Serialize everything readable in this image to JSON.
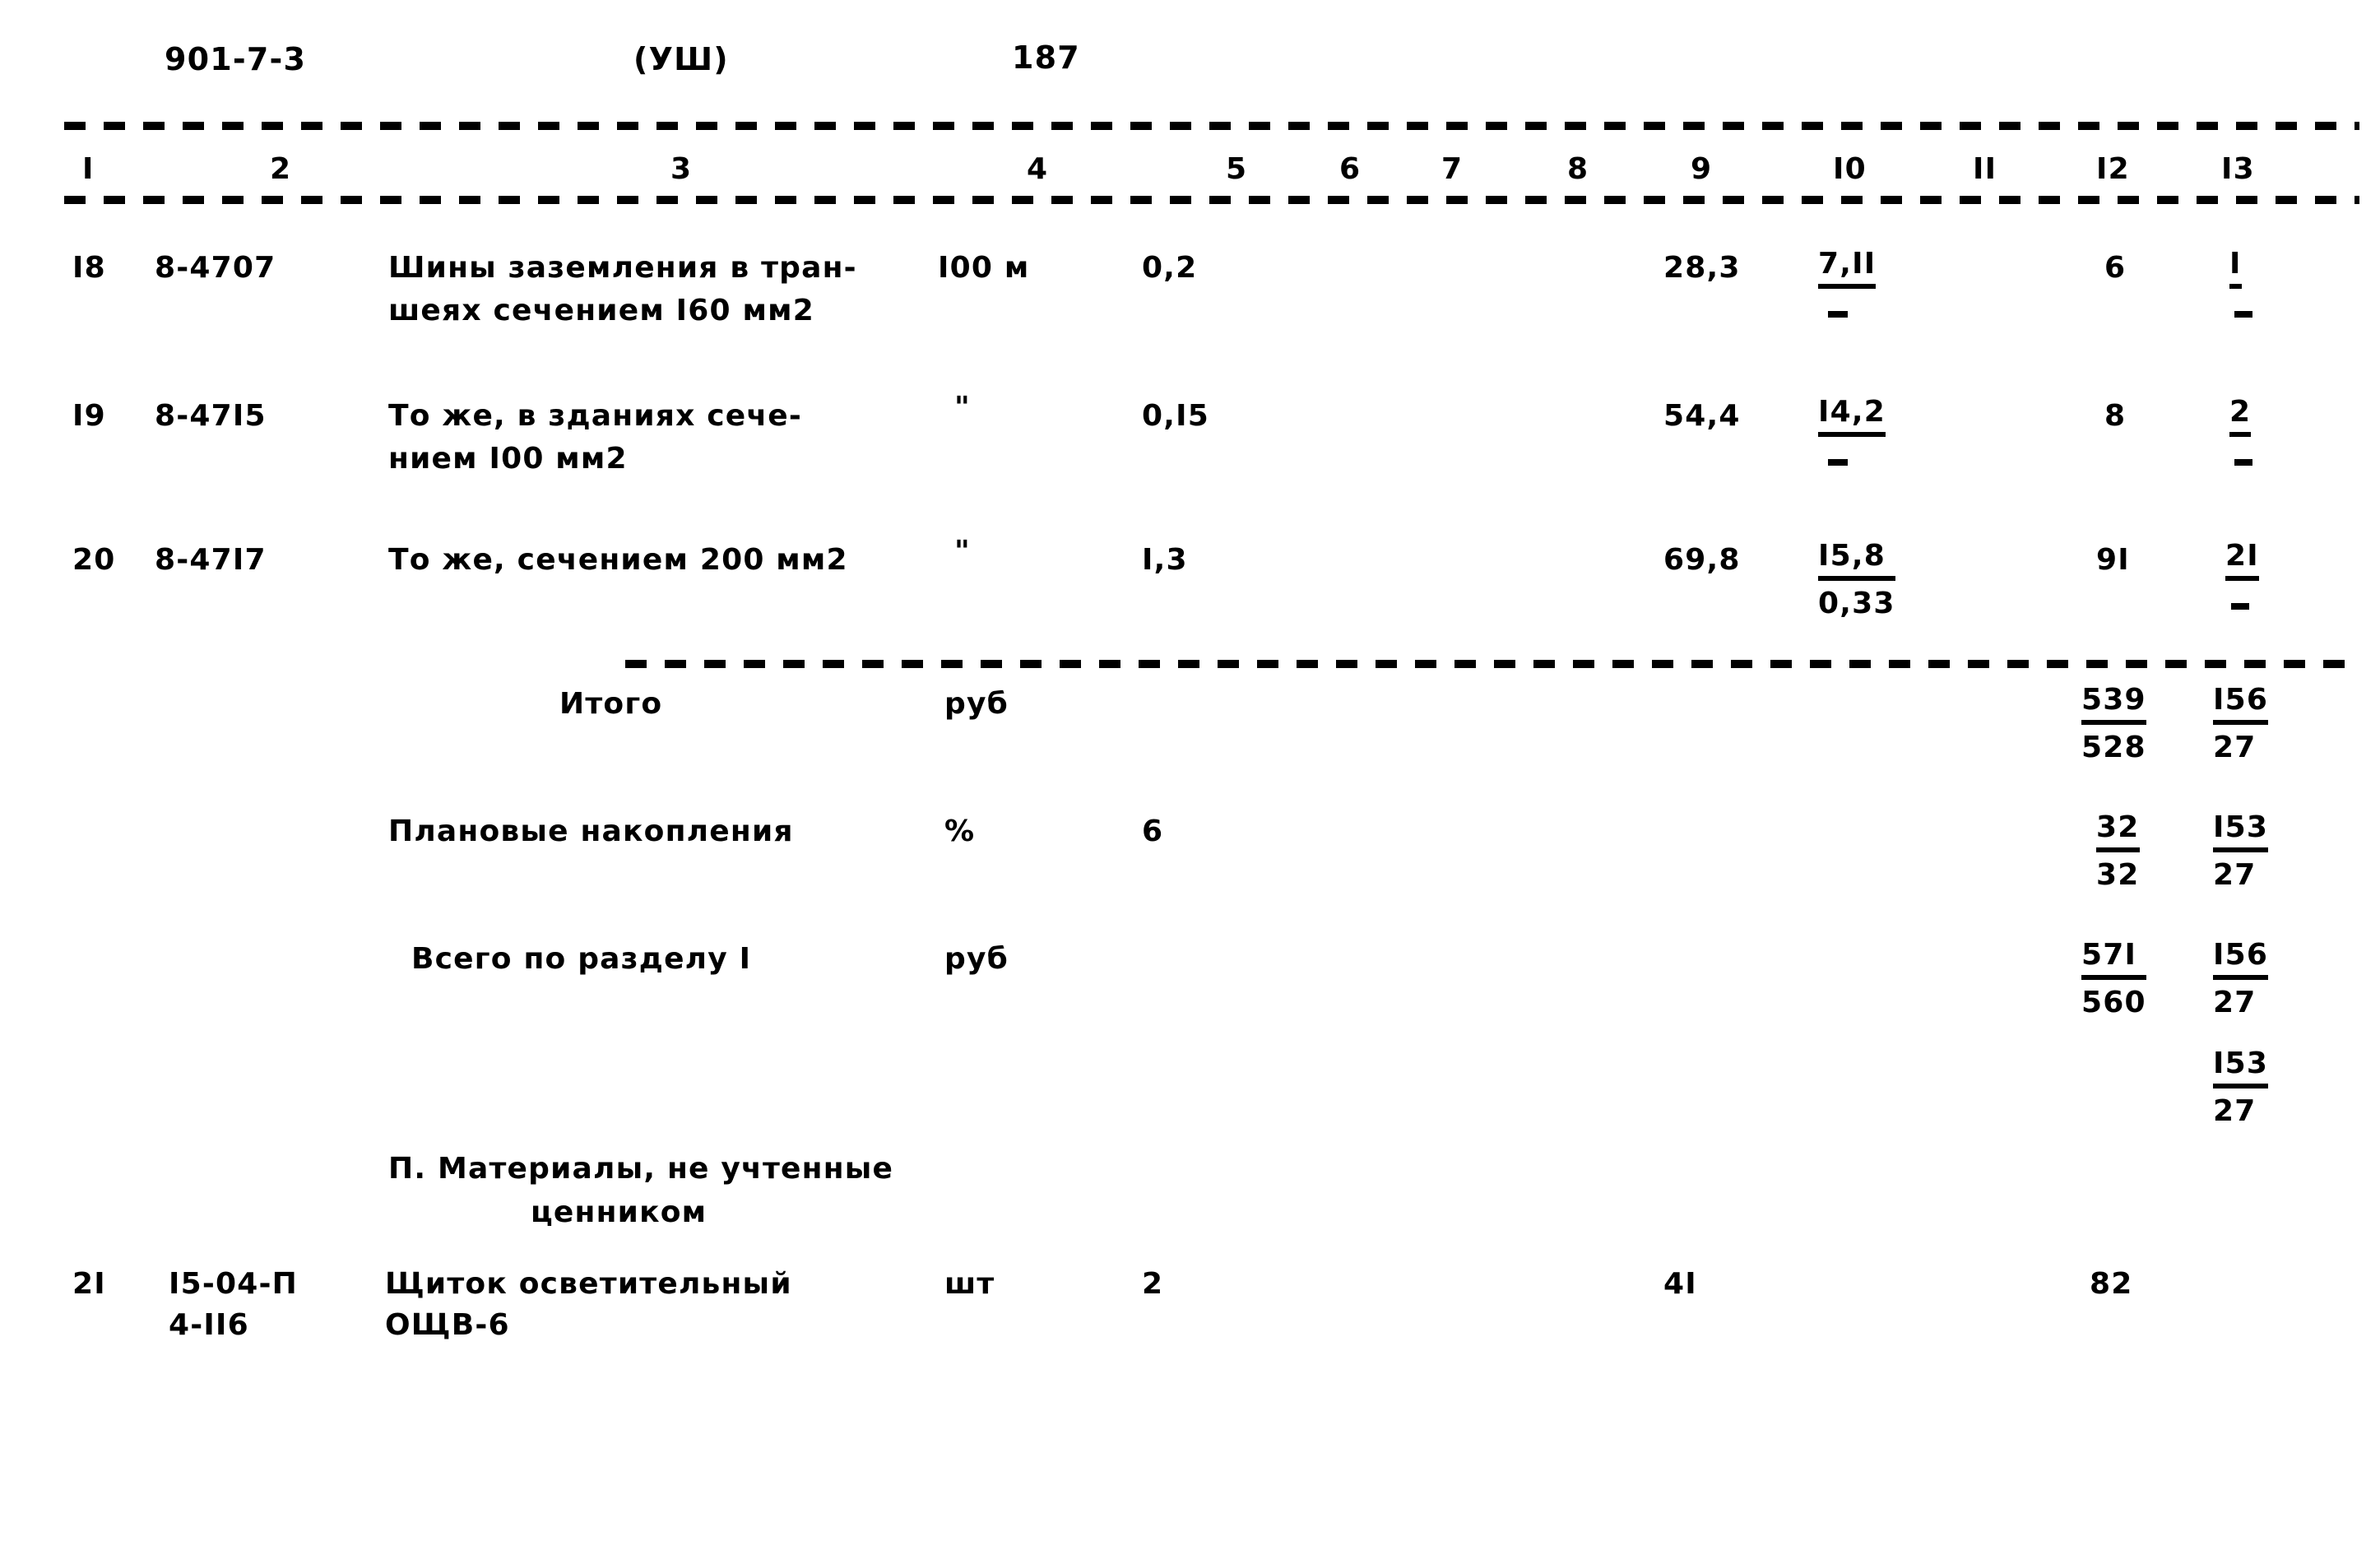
{
  "header": {
    "doc_code": "901-7-3",
    "series": "(УШ)",
    "page_number": "187"
  },
  "table": {
    "column_numbers": [
      "I",
      "2",
      "3",
      "4",
      "5",
      "6",
      "7",
      "8",
      "9",
      "I0",
      "II",
      "I2",
      "I3"
    ],
    "rows": [
      {
        "num": "I8",
        "code": "8-4707",
        "desc_line1": "Шины заземления в тран-",
        "desc_line2": "шеях сечением I60 мм2",
        "unit": "I00 м",
        "qty": "0,2",
        "col9": "28,3",
        "col10_top": "7,II",
        "col10_bot": "",
        "col12": "6",
        "col13_top": "I",
        "col13_bot": ""
      },
      {
        "num": "I9",
        "code": "8-47I5",
        "desc_line1": "То же, в зданиях сече-",
        "desc_line2": "нием I00 мм2",
        "unit": "\"",
        "qty": "0,I5",
        "col9": "54,4",
        "col10_top": "I4,2",
        "col10_bot": "",
        "col12": "8",
        "col13_top": "2",
        "col13_bot": ""
      },
      {
        "num": "20",
        "code": "8-47I7",
        "desc_line1": "То же, сечением 200 мм2",
        "desc_line2": "",
        "unit": "\"",
        "qty": "I,3",
        "col9": "69,8",
        "col10_top": "I5,8",
        "col10_bot": "0,33",
        "col12": "9I",
        "col13_top": "2I",
        "col13_bot": ""
      }
    ],
    "summary_rows": [
      {
        "label": "Итого",
        "unit": "руб",
        "qty": "",
        "col12_top": "539",
        "col12_bot": "528",
        "col13_top": "I56",
        "col13_bot": "27"
      },
      {
        "label": "Плановые накопления",
        "unit": "%",
        "qty": "6",
        "col12_top": "32",
        "col12_bot": "32",
        "col13_top": "I53",
        "col13_bot": "27"
      },
      {
        "label": "Всего по разделу I",
        "unit": "руб",
        "qty": "",
        "col12_top": "57I",
        "col12_bot": "560",
        "col13_top": "I56",
        "col13_bot": "27",
        "col13_extra_top": "I53",
        "col13_extra_bot": "27"
      }
    ],
    "section_heading": {
      "line1": "П. Материалы, не учтенные",
      "line2": "ценником"
    },
    "materials_rows": [
      {
        "num": "2I",
        "code_line1": "I5-04-П",
        "code_line2": "4-II6",
        "desc_line1": "Щиток осветительный",
        "desc_line2": "ОЩВ-6",
        "unit": "шт",
        "qty": "2",
        "col9": "4I",
        "col12": "82"
      }
    ]
  }
}
